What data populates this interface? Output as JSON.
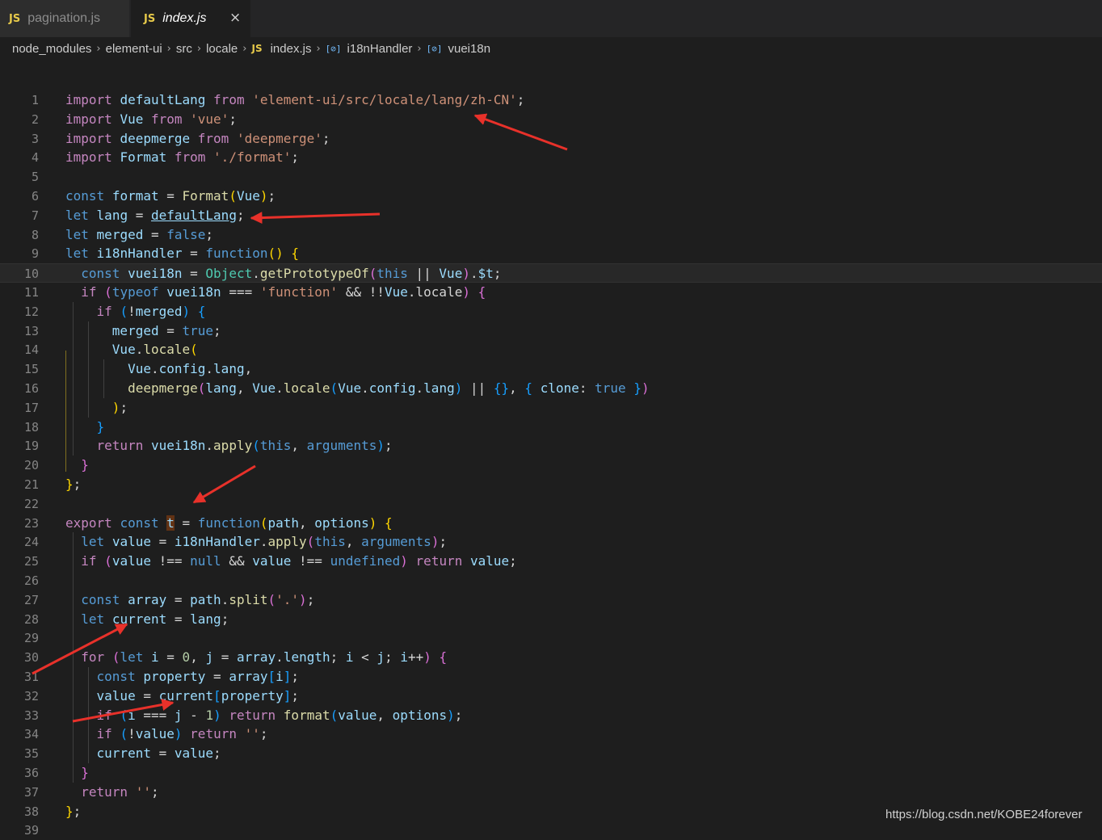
{
  "tabs": [
    {
      "badge": "JS",
      "label": "pagination.js",
      "active": false
    },
    {
      "badge": "JS",
      "label": "index.js",
      "active": true,
      "close": "×"
    }
  ],
  "breadcrumb": {
    "parts": [
      "node_modules",
      "element-ui",
      "src",
      "locale"
    ],
    "file_badge": "JS",
    "file": "index.js",
    "symbol_icon": "[⊘]",
    "symbols": [
      "i18nHandler",
      "vuei18n"
    ]
  },
  "editor": {
    "line_numbers": [
      "1",
      "2",
      "3",
      "4",
      "5",
      "6",
      "7",
      "8",
      "9",
      "10",
      "11",
      "12",
      "13",
      "14",
      "15",
      "16",
      "17",
      "18",
      "19",
      "20",
      "21",
      "22",
      "23",
      "24",
      "25",
      "26",
      "27",
      "28",
      "29",
      "30",
      "31",
      "32",
      "33",
      "34",
      "35",
      "36",
      "37",
      "38",
      "39"
    ],
    "lines": [
      "import defaultLang from 'element-ui/src/locale/lang/zh-CN';",
      "import Vue from 'vue';",
      "import deepmerge from 'deepmerge';",
      "import Format from './format';",
      "",
      "const format = Format(Vue);",
      "let lang = defaultLang;",
      "let merged = false;",
      "let i18nHandler = function() {",
      "  const vuei18n = Object.getPrototypeOf(this || Vue).$t;",
      "  if (typeof vuei18n === 'function' && !!Vue.locale) {",
      "    if (!merged) {",
      "      merged = true;",
      "      Vue.locale(",
      "        Vue.config.lang,",
      "        deepmerge(lang, Vue.locale(Vue.config.lang) || {}, { clone: true })",
      "      );",
      "    }",
      "    return vuei18n.apply(this, arguments);",
      "  }",
      "};",
      "",
      "export const t = function(path, options) {",
      "  let value = i18nHandler.apply(this, arguments);",
      "  if (value !== null && value !== undefined) return value;",
      "",
      "  const array = path.split('.');",
      "  let current = lang;",
      "",
      "  for (let i = 0, j = array.length; i < j; i++) {",
      "    const property = array[i];",
      "    value = current[property];",
      "    if (i === j - 1) return format(value, options);",
      "    if (!value) return '';",
      "    current = value;",
      "  }",
      "  return '';",
      "};",
      ""
    ]
  },
  "colors": {
    "background": "#1e1e1e",
    "keyword": "#569cd6",
    "string": "#ce9178",
    "annotation_arrow": "#e8312a"
  },
  "watermark": "https://blog.csdn.net/KOBE24forever"
}
